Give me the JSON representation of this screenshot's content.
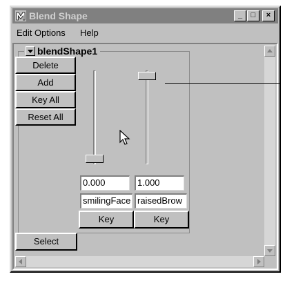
{
  "window": {
    "title": "Blend Shape",
    "minimize": "_",
    "maximize": "□",
    "close": "×"
  },
  "menu": {
    "items": [
      "Edit",
      "Options",
      "Help"
    ]
  },
  "blend_shape": {
    "node": "blendShape1",
    "buttons": {
      "delete": "Delete",
      "add": "Add",
      "key_all": "Key All",
      "reset_all": "Reset All"
    },
    "targets": [
      {
        "name": "smilingFace",
        "weight": "0.000",
        "key_label": "Key",
        "slider_fraction": 0.0
      },
      {
        "name": "raisedBrow",
        "weight": "1.000",
        "key_label": "Key",
        "slider_fraction": 1.0
      }
    ],
    "select_label": "Select"
  }
}
